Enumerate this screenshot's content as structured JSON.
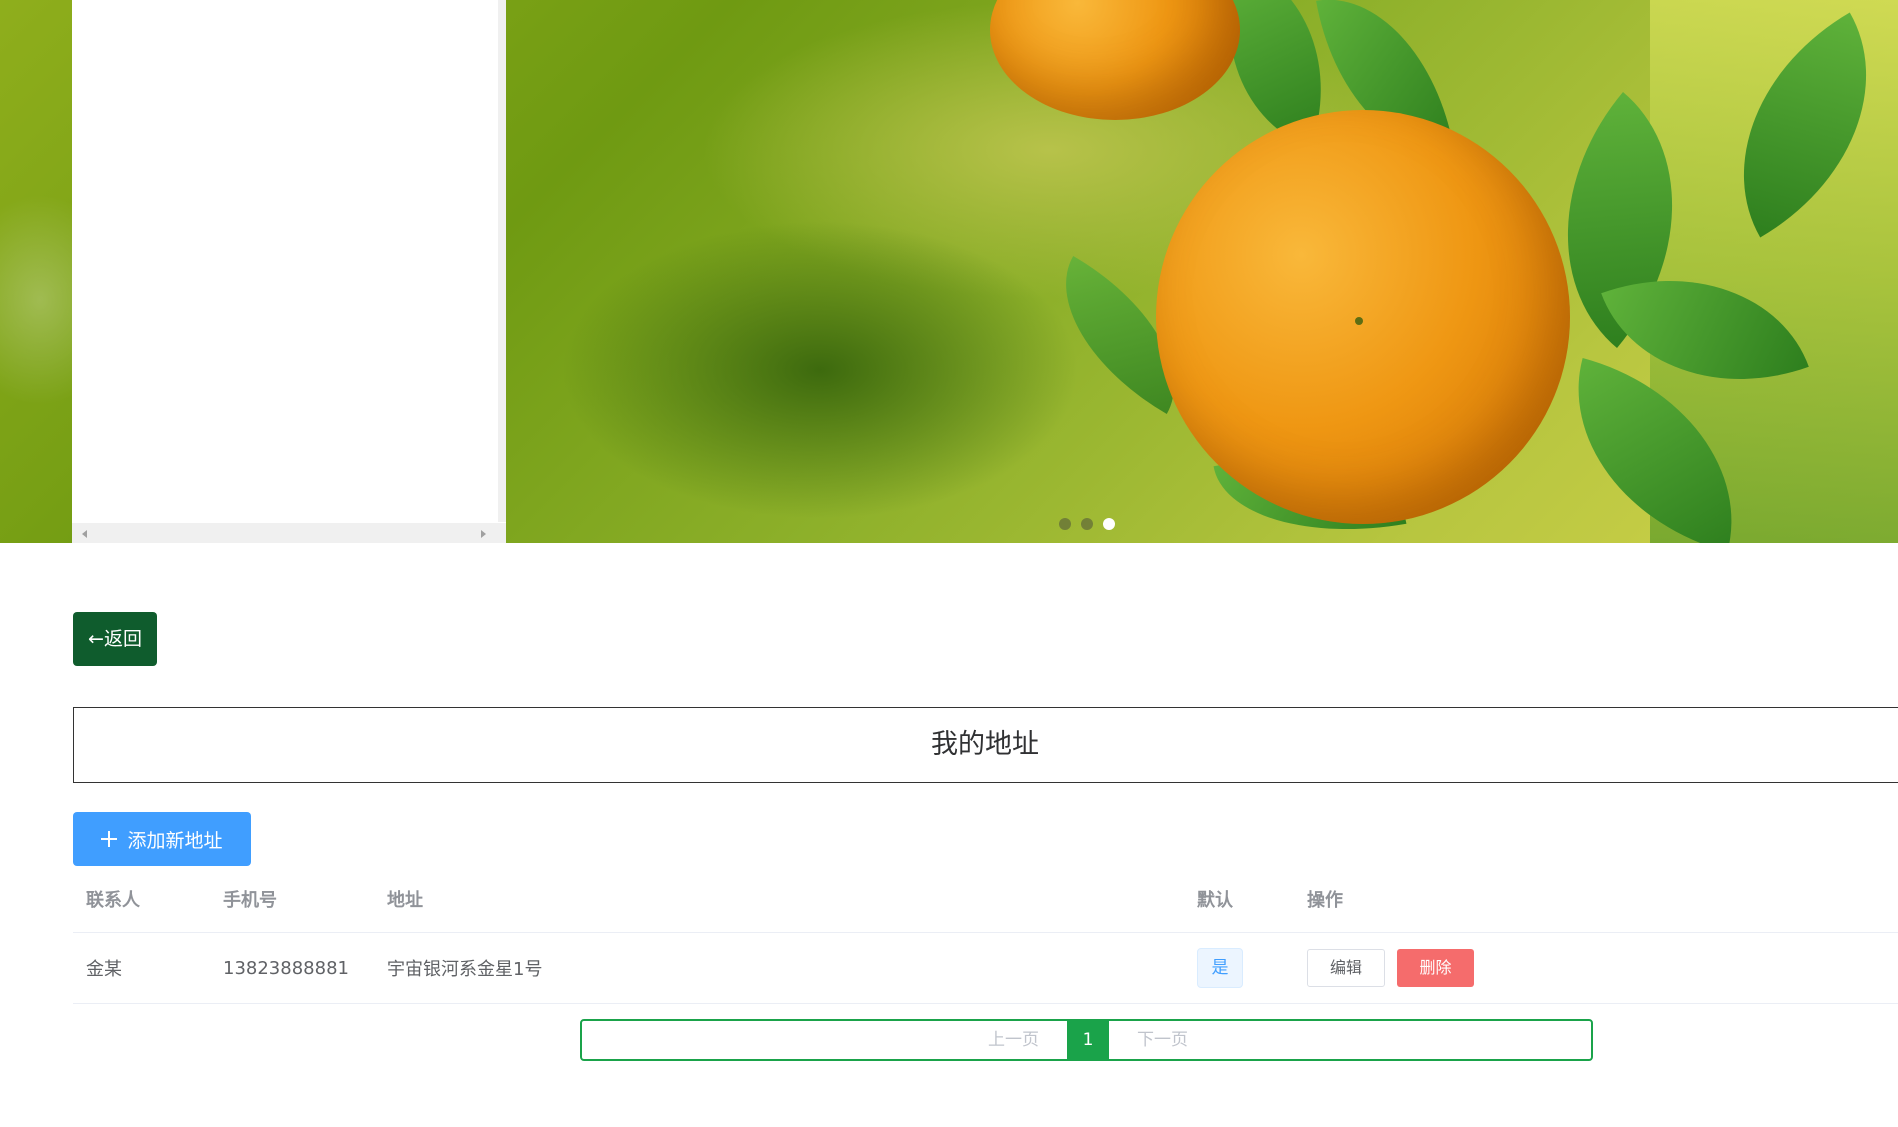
{
  "banner": {
    "slide_count": 3,
    "active_slide": 3
  },
  "back_button": {
    "label": "←返回"
  },
  "page_title": "我的地址",
  "add_button": {
    "label": "添加新地址",
    "icon": "plus-icon"
  },
  "table": {
    "headers": [
      "联系人",
      "手机号",
      "地址",
      "默认",
      "操作"
    ],
    "rows": [
      {
        "contact": "金某",
        "phone": "13823888881",
        "address": "宇宙银河系金星1号",
        "default": "是",
        "edit_label": "编辑",
        "delete_label": "删除"
      }
    ]
  },
  "pagination": {
    "prev_label": "上一页",
    "current_page": "1",
    "next_label": "下一页"
  },
  "colors": {
    "back_button": "#0f5c2d",
    "add_button": "#409eff",
    "delete_button": "#f56c6c",
    "pager_accent": "#1aa34a"
  }
}
